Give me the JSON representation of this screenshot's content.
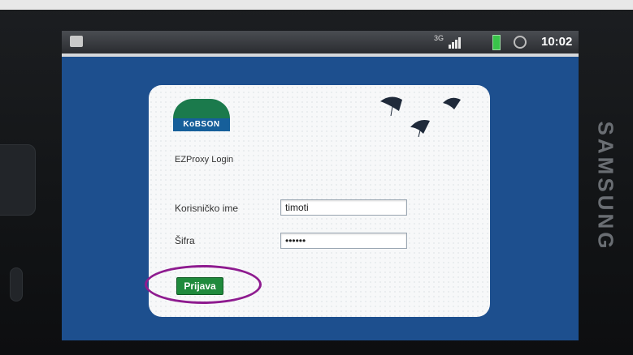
{
  "device": {
    "brand": "SAMSUNG",
    "status_bar": {
      "network": "3G",
      "time": "10:02"
    }
  },
  "login": {
    "logo_text": "KoBSON",
    "title": "EZProxy Login",
    "username_label": "Korisničko ime",
    "username_value": "timoti",
    "password_label": "Šifra",
    "password_value": "••••••",
    "submit_label": "Prijava"
  },
  "colors": {
    "screen_background": "#1d4f8e",
    "button": "#1f8a3c",
    "highlight_ring": "#8e1b8f"
  }
}
